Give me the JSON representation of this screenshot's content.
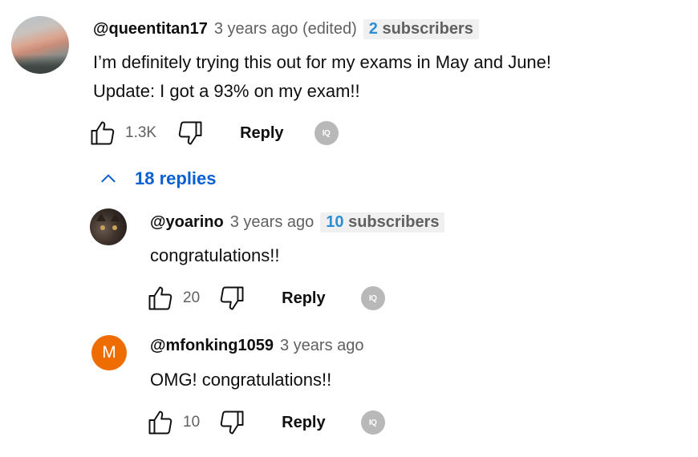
{
  "comment": {
    "handle": "@queentitan17",
    "time": "3 years ago (edited)",
    "subscribers_count": "2",
    "subscribers_word": "subscribers",
    "text_line1": "I’m definitely trying this out for my exams in May and June!",
    "text_line2": "Update: I got a 93% on my exam!!",
    "likes": "1.3K",
    "reply_label": "Reply",
    "iq_label": "IQ"
  },
  "replies_toggle": {
    "label": "18 replies",
    "icon": "chevron-up-icon"
  },
  "replies": [
    {
      "handle": "@yoarino",
      "time": "3 years ago",
      "subscribers_count": "10",
      "subscribers_word": "subscribers",
      "text": "congratulations!!",
      "likes": "20",
      "reply_label": "Reply",
      "iq_label": "IQ"
    },
    {
      "handle": "@mfonking1059",
      "time": "3 years ago",
      "avatar_letter": "M",
      "avatar_color": "#ef6c00",
      "text": "OMG! congratulations!!",
      "likes": "10",
      "reply_label": "Reply",
      "iq_label": "IQ"
    }
  ],
  "colors": {
    "link_blue": "#065fd4",
    "subscriber_number": "#2a8fd6",
    "meta_gray": "#606060"
  }
}
